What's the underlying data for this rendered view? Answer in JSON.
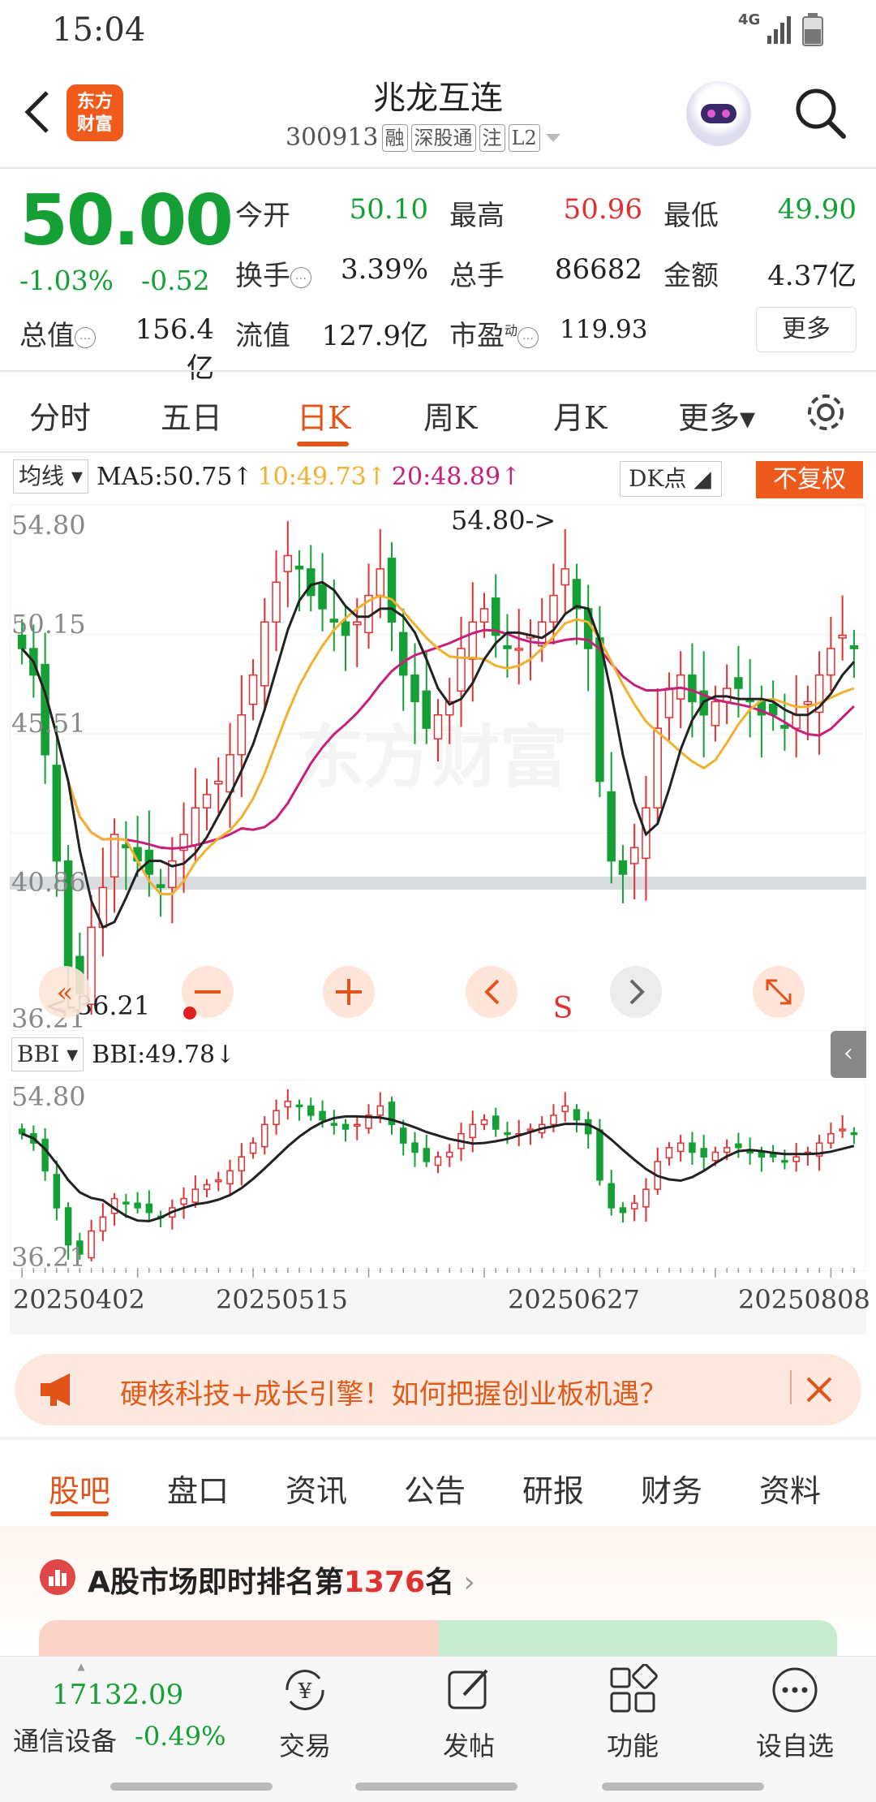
{
  "status_bar": {
    "time": "15:04",
    "network": "4G"
  },
  "header": {
    "logo_line1": "东方",
    "logo_line2": "财富",
    "stock_name": "兆龙互连",
    "code": "300913",
    "tags": [
      "融",
      "深股通",
      "注",
      "L2"
    ]
  },
  "quote": {
    "price": "50.00",
    "change_pct": "-1.03%",
    "change": "-0.52",
    "open_label": "今开",
    "open": "50.10",
    "high_label": "最高",
    "high": "50.96",
    "low_label": "最低",
    "low": "49.90",
    "turnover_label": "换手",
    "turnover": "3.39%",
    "volume_label": "总手",
    "volume": "86682",
    "amount_label": "金额",
    "amount": "4.37亿",
    "mktcap_label": "总值",
    "mktcap": "156.4亿",
    "float_label": "流值",
    "float_cap": "127.9亿",
    "pe_label": "市盈",
    "pe_sup": "动",
    "pe": "119.93",
    "more_label": "更多"
  },
  "chart_tabs": [
    "分时",
    "五日",
    "日K",
    "周K",
    "月K",
    "更多▾"
  ],
  "active_chart_tab": "日K",
  "ma_bar": {
    "selector": "均线",
    "ma5": "MA5:50.75↑",
    "ma10": "10:49.73↑",
    "ma20": "20:48.89↑",
    "dk": "DK点",
    "adjust": "不复权"
  },
  "kchart": {
    "y_max": "54.80",
    "y_2": "50.15",
    "y_3": "45.51",
    "y_4": "40.86",
    "y_min": "36.21",
    "max_marker": "54.80->",
    "min_marker": "<-36.21",
    "s_marker": "S",
    "watermark": "东方财富"
  },
  "bbi": {
    "selector": "BBI",
    "value": "BBI:49.78↓",
    "y_max": "54.80",
    "y_min": "36.21"
  },
  "dates": [
    "20250402",
    "20250515",
    "20250627",
    "20250808"
  ],
  "colors": {
    "up": "#e03030",
    "down": "#15a035",
    "accent": "#e0541a",
    "ma5": "#222222",
    "ma10": "#f0b030",
    "ma20": "#c8207a"
  },
  "chart_data": {
    "type": "candlestick",
    "x_range": [
      "20250402",
      "20250808"
    ],
    "ylim": [
      36.21,
      54.8
    ],
    "y_ticks": [
      54.8,
      50.15,
      45.51,
      40.86,
      36.21
    ],
    "max": 54.8,
    "min": 36.21,
    "indicators": {
      "MA5": 50.75,
      "MA10": 49.73,
      "MA20": 48.89,
      "BBI": 49.78
    },
    "grid": true
  },
  "banner": {
    "text": "硬核科技+成长引擎！如何把握创业板机遇？"
  },
  "bottom_tabs": [
    "股吧",
    "盘口",
    "资讯",
    "公告",
    "研报",
    "财务",
    "资料"
  ],
  "active_bottom_tab": "股吧",
  "rank": {
    "prefix": "A股市场即时排名第",
    "number": "1376",
    "suffix": "名"
  },
  "bottom_nav": {
    "index_value": "17132.09",
    "index_name": "通信设备",
    "index_change": "-0.49%",
    "items": [
      "交易",
      "发帖",
      "功能",
      "设自选"
    ]
  }
}
